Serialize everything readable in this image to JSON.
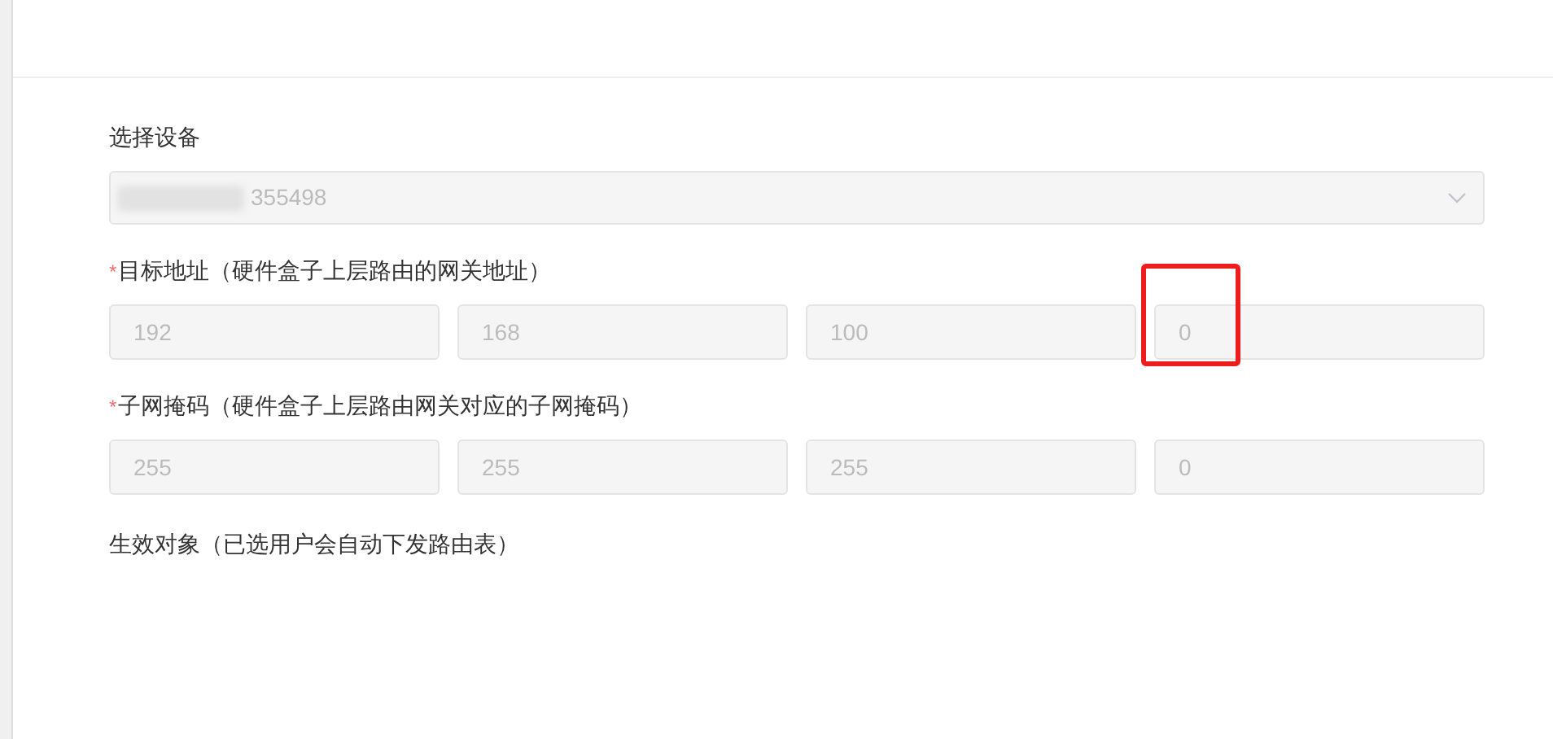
{
  "device": {
    "label": "选择设备",
    "value": "355498",
    "redacted": true,
    "disabled": true
  },
  "gateway": {
    "required_mark": "*",
    "label": "目标地址（硬件盒子上层路由的网关地址）",
    "octets": [
      {
        "value": "192",
        "disabled": true
      },
      {
        "value": "168",
        "disabled": true
      },
      {
        "value": "100",
        "disabled": true
      },
      {
        "value": "0",
        "disabled": true,
        "highlighted": true
      }
    ]
  },
  "subnet": {
    "required_mark": "*",
    "label": "子网掩码（硬件盒子上层路由网关对应的子网掩码）",
    "octets": [
      {
        "value": "255",
        "disabled": true
      },
      {
        "value": "255",
        "disabled": true
      },
      {
        "value": "255",
        "disabled": true
      },
      {
        "value": "0",
        "disabled": true,
        "highlighted": false
      }
    ]
  },
  "targets": {
    "label": "生效对象（已选用户会自动下发路由表）"
  }
}
